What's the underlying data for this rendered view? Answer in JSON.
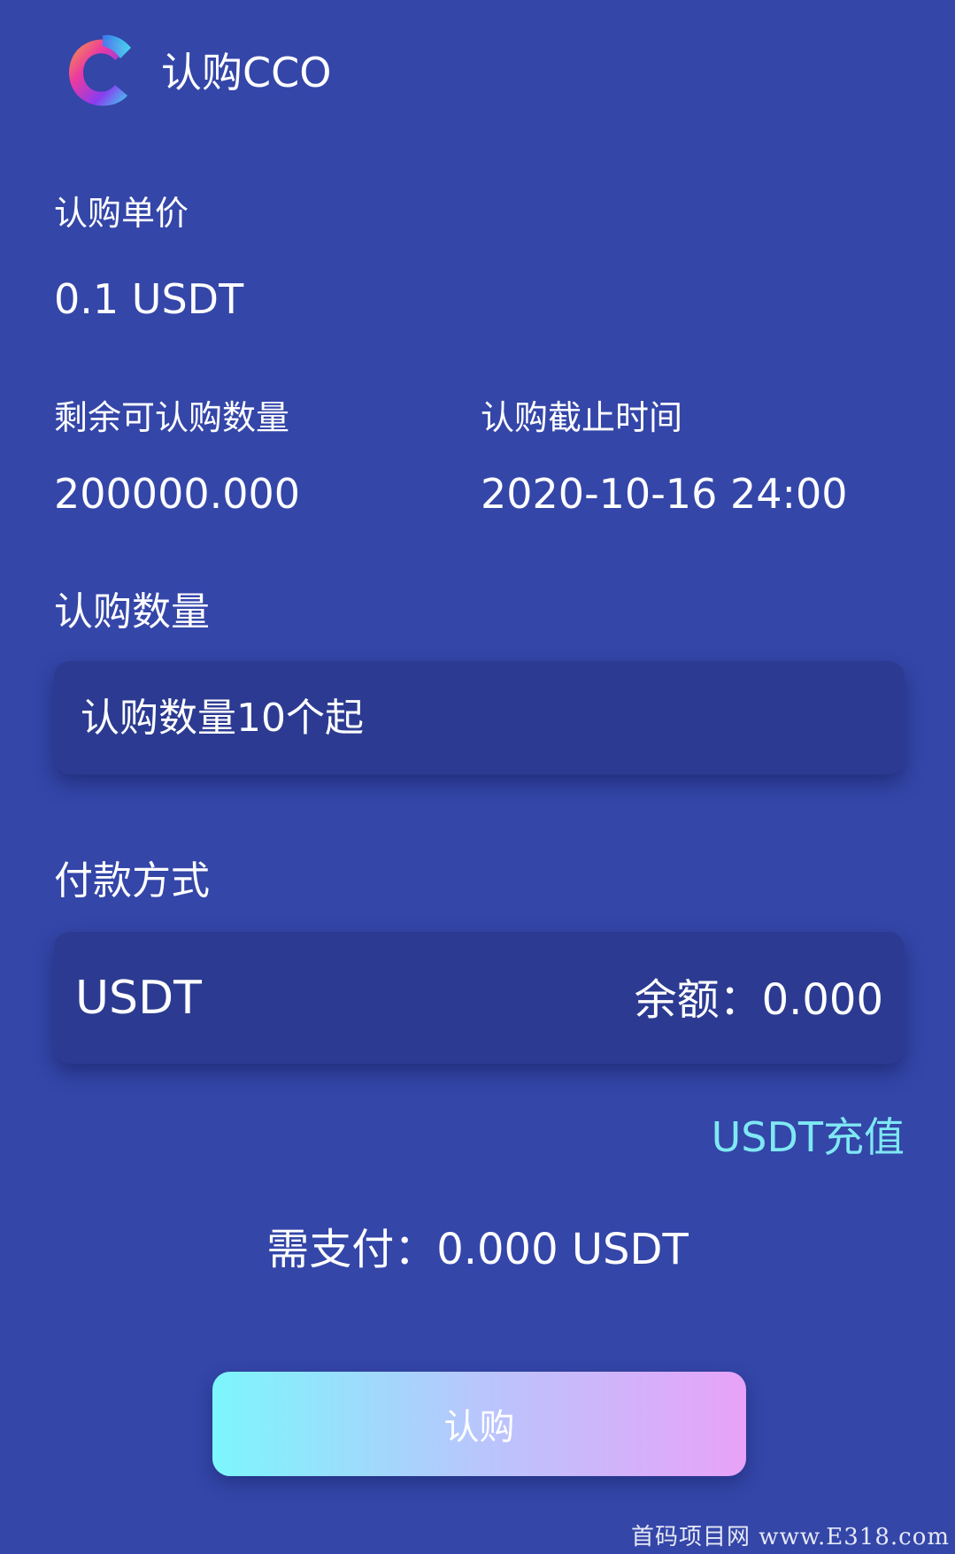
{
  "header": {
    "logo_icon": "cco-c-logo",
    "title": "认购CCO"
  },
  "price": {
    "label": "认购单价",
    "value": "0.1 USDT"
  },
  "remaining": {
    "label": "剩余可认购数量",
    "value": "200000.000"
  },
  "deadline": {
    "label": "认购截止时间",
    "value": "2020-10-16 24:00"
  },
  "quantity": {
    "label": "认购数量",
    "placeholder": "认购数量10个起"
  },
  "payment": {
    "label": "付款方式",
    "method": "USDT",
    "balance": "余额：0.000"
  },
  "recharge_link": "USDT充值",
  "total": "需支付：0.000 USDT",
  "submit_label": "认购",
  "watermark": "首码项目网 www.E318.com",
  "colors": {
    "background": "#3446a8",
    "panel": "#2c3b91",
    "link": "#7fe8f4",
    "button_gradient_start": "#7cf6fc",
    "button_gradient_end": "#e8a2f8"
  }
}
